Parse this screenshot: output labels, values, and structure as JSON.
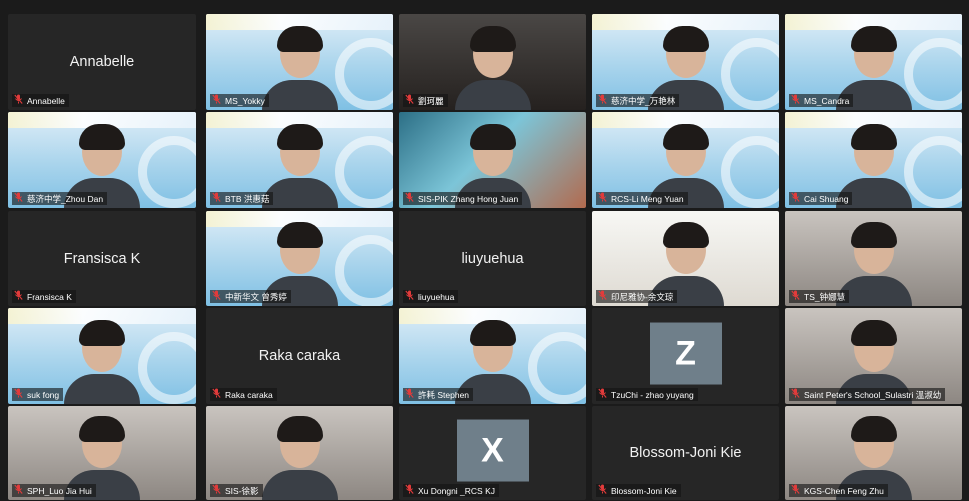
{
  "icons": {
    "muted": "mic-muted-icon"
  },
  "tiles": [
    {
      "name": "Annabelle",
      "label": "Annabelle",
      "type": "name"
    },
    {
      "name": "MS_Yokky",
      "label": "MS_Yokky",
      "type": "video",
      "style": "banner"
    },
    {
      "name": "劉珂麗",
      "label": "劉珂麗",
      "type": "video",
      "style": "dark"
    },
    {
      "name": "慈济中学_万艳林",
      "label": "慈济中学_万艳林",
      "type": "video",
      "style": "banner"
    },
    {
      "name": "MS_Candra",
      "label": "MS_Candra",
      "type": "video",
      "style": "banner"
    },
    {
      "name": "慈济中学_Zhou Dan",
      "label": "慈济中学_Zhou Dan",
      "type": "video",
      "style": "banner"
    },
    {
      "name": "BTB 洪惠菇",
      "label": "BTB 洪惠菇",
      "type": "video",
      "style": "banner"
    },
    {
      "name": "SIS-PIK Zhang Hong Juan",
      "label": "SIS-PIK Zhang Hong Juan",
      "type": "video",
      "style": "sea"
    },
    {
      "name": "RCS-Li Meng Yuan",
      "label": "RCS-Li Meng Yuan",
      "type": "video",
      "style": "banner"
    },
    {
      "name": "Cai Shuang",
      "label": "Cai Shuang",
      "type": "video",
      "style": "banner"
    },
    {
      "name": "Fransisca K",
      "label": "Fransisca K",
      "type": "name"
    },
    {
      "name": "中新华文 曾秀婷",
      "label": "中新华文 曾秀婷",
      "type": "video",
      "style": "banner"
    },
    {
      "name": "liuyuehua",
      "label": "liuyuehua",
      "type": "name"
    },
    {
      "name": "印尼雅协-余文琼",
      "label": "印尼雅协-余文琼",
      "type": "video",
      "style": "white"
    },
    {
      "name": "TS_钟娜慧",
      "label": "TS_钟娜慧",
      "type": "video",
      "style": "plain"
    },
    {
      "name": "suk fong",
      "label": "suk fong",
      "type": "video",
      "style": "banner"
    },
    {
      "name": "Raka caraka",
      "label": "Raka caraka",
      "type": "name"
    },
    {
      "name": "許耗 Stephen",
      "label": "許耗 Stephen",
      "type": "video",
      "style": "banner"
    },
    {
      "name": "TzuChi - zhao yuyang",
      "label": "TzuChi - zhao yuyang",
      "type": "letter",
      "letter": "Z"
    },
    {
      "name": "Saint Peter's School_Sulastri 溫淑幼",
      "label": "Saint Peter's School_Sulastri 溫淑幼",
      "type": "video",
      "style": "plain"
    },
    {
      "name": "SPH_Luo Jia Hui",
      "label": "SPH_Luo Jia Hui",
      "type": "video",
      "style": "plain"
    },
    {
      "name": "SIS-徐影",
      "label": "SIS-徐影",
      "type": "video",
      "style": "plain"
    },
    {
      "name": "Xu Dongni _RCS KJ",
      "label": "Xu Dongni _RCS KJ",
      "type": "letter",
      "letter": "X"
    },
    {
      "name": "Blossom-Joni Kie",
      "label": "Blossom-Joni Kie",
      "type": "name"
    },
    {
      "name": "KGS-Chen Feng Zhu",
      "label": "KGS-Chen Feng Zhu",
      "type": "video",
      "style": "plain"
    }
  ]
}
